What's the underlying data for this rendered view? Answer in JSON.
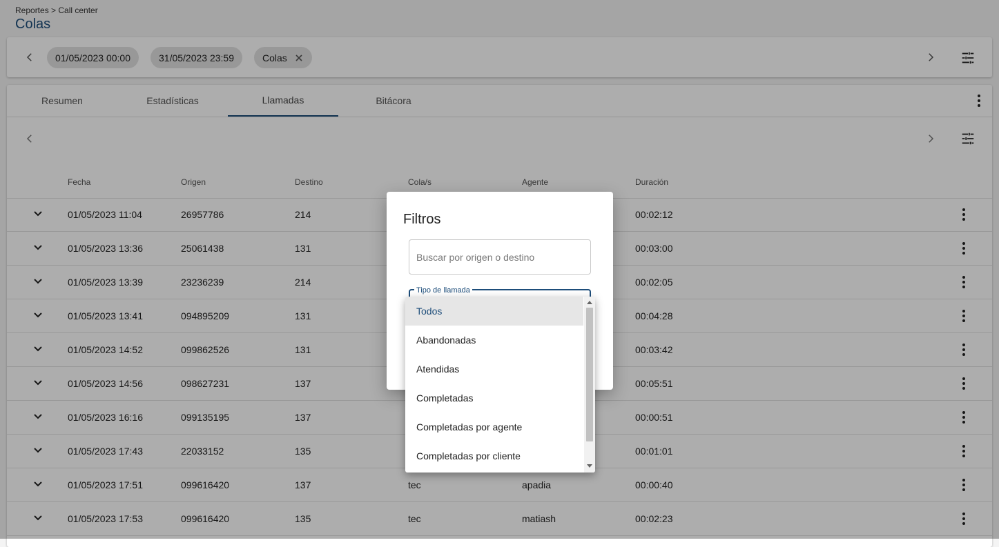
{
  "breadcrumb": "Reportes > Call center",
  "page_title": "Colas",
  "filters": {
    "chips": [
      {
        "label": "01/05/2023 00:00"
      },
      {
        "label": "31/05/2023 23:59"
      },
      {
        "label": "Colas",
        "removable": true
      }
    ]
  },
  "tabs": [
    {
      "label": "Resumen"
    },
    {
      "label": "Estadísticas"
    },
    {
      "label": "Llamadas",
      "active": true
    },
    {
      "label": "Bitácora"
    }
  ],
  "table": {
    "columns": [
      "Fecha",
      "Origen",
      "Destino",
      "Cola/s",
      "Agente",
      "Duración"
    ],
    "rows": [
      {
        "fecha": "01/05/2023 11:04",
        "origen": "26957786",
        "destino": "214",
        "cola": "",
        "agente": "",
        "duracion": "00:02:12"
      },
      {
        "fecha": "01/05/2023 13:36",
        "origen": "25061438",
        "destino": "131",
        "cola": "",
        "agente": "",
        "duracion": "00:03:00"
      },
      {
        "fecha": "01/05/2023 13:39",
        "origen": "23236239",
        "destino": "214",
        "cola": "",
        "agente": "",
        "duracion": "00:02:05"
      },
      {
        "fecha": "01/05/2023 13:41",
        "origen": "094895209",
        "destino": "131",
        "cola": "",
        "agente": "",
        "duracion": "00:04:28"
      },
      {
        "fecha": "01/05/2023 14:52",
        "origen": "099862526",
        "destino": "131",
        "cola": "",
        "agente": "",
        "duracion": "00:03:42"
      },
      {
        "fecha": "01/05/2023 14:56",
        "origen": "098627231",
        "destino": "137",
        "cola": "",
        "agente": "",
        "duracion": "00:05:51"
      },
      {
        "fecha": "01/05/2023 16:16",
        "origen": "099135195",
        "destino": "137",
        "cola": "",
        "agente": "",
        "duracion": "00:00:51"
      },
      {
        "fecha": "01/05/2023 17:43",
        "origen": "22033152",
        "destino": "135",
        "cola": "",
        "agente": "",
        "duracion": "00:01:01"
      },
      {
        "fecha": "01/05/2023 17:51",
        "origen": "099616420",
        "destino": "137",
        "cola": "tec",
        "agente": "apadia",
        "duracion": "00:00:40"
      },
      {
        "fecha": "01/05/2023 17:53",
        "origen": "099616420",
        "destino": "135",
        "cola": "tec",
        "agente": "matiash",
        "duracion": "00:02:23"
      }
    ]
  },
  "dialog": {
    "title": "Filtros",
    "search_placeholder": "Buscar por origen o destino",
    "select_label": "Tipo de llamada",
    "options": [
      {
        "label": "Todos",
        "selected": true
      },
      {
        "label": "Abandonadas"
      },
      {
        "label": "Atendidas"
      },
      {
        "label": "Completadas"
      },
      {
        "label": "Completadas por agente"
      },
      {
        "label": "Completadas por cliente"
      }
    ]
  },
  "colors": {
    "accent": "#1d4d7a",
    "overlay": "rgba(0,0,0,0.32)",
    "chip": "#e0e0e0"
  }
}
